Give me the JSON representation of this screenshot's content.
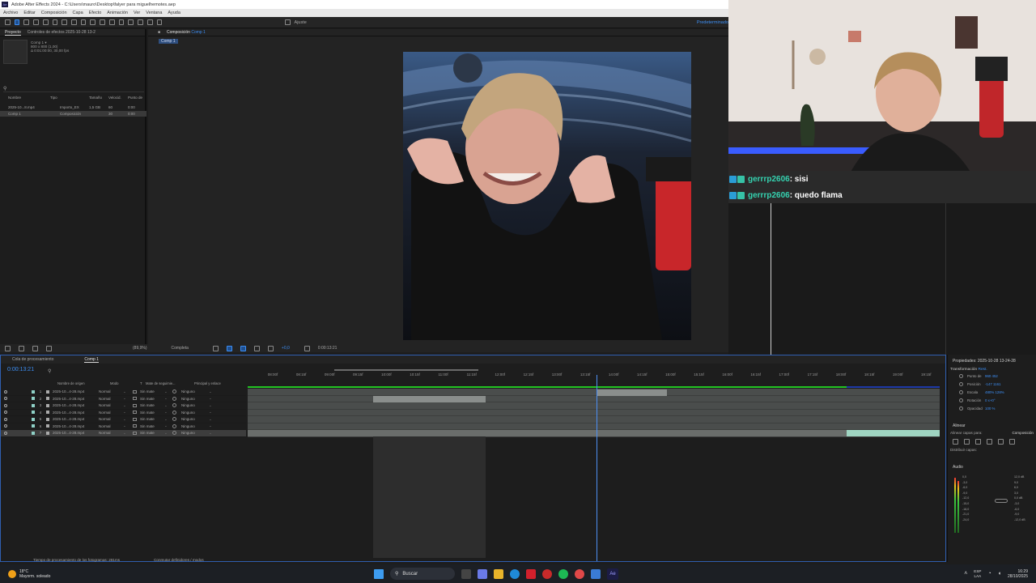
{
  "app": {
    "title": "Adobe After Effects 2024 - C:\\Users\\mauro\\Desktop\\falyer para miguelhemotes.aep",
    "menu": [
      "Archivo",
      "Editar",
      "Composición",
      "Capa",
      "Efecto",
      "Animación",
      "Ver",
      "Ventana",
      "Ayuda"
    ],
    "workspace": "Predeterminado",
    "ajuste": "Ajuste"
  },
  "project": {
    "tabs": [
      "Proyecto",
      "Controles de efectos 2025-10-28 13-2"
    ],
    "comp_name": "Comp 1 ▾",
    "comp_info": [
      "800 x 800 (1,00)",
      "Δ 0:01:00:00, 30,00 fps"
    ],
    "columns": [
      "Nombre",
      "Tipo",
      "Tamaño",
      "Velocid.",
      "Punto de"
    ],
    "items": [
      {
        "name": "2025-10...8.mp4",
        "type": "Importo_EX",
        "size": "1,5 GB",
        "speed": "60",
        "point": "0:00"
      },
      {
        "name": "Comp 1",
        "type": "Composición",
        "size": "",
        "speed": "30",
        "point": "0:00"
      }
    ]
  },
  "composition": {
    "tab_label": "Composición",
    "tab_comp": "Comp 1",
    "breadcrumb": "Comp 1",
    "zoom": "(89,9%)",
    "resolution": "Completa",
    "exposure": "+0,0",
    "current_time": "0:00:13:21"
  },
  "chat": {
    "messages": [
      {
        "user": "gerrrp2606",
        "text": " : sisi"
      },
      {
        "user": "gerrrp2606",
        "text": " : quedo flama"
      }
    ]
  },
  "timeline": {
    "tabs": [
      "Cola de procesamiento",
      "Comp 1"
    ],
    "timecode": "0:00:13:21",
    "columns": [
      "Nombre de origen",
      "Modo",
      "T",
      "Mate de seguimie...",
      "Principal y enlace"
    ],
    "ruler": [
      "08:00f",
      "08:15f",
      "09:00f",
      "09:15f",
      "10:00f",
      "10:15f",
      "11:00f",
      "11:15f",
      "12:00f",
      "12:15f",
      "13:00f",
      "13:15f",
      "14:00f",
      "14:15f",
      "15:00f",
      "15:15f",
      "16:00f",
      "16:15f",
      "17:00f",
      "17:15f",
      "18:00f",
      "18:15f",
      "19:00f",
      "19:15f"
    ],
    "layers": [
      {
        "n": "1",
        "name": "2025-10...4-28.mp4",
        "mode": "Normal",
        "matte": "Sin mate",
        "parent": "Ninguno"
      },
      {
        "n": "2",
        "name": "2025-10...4-28.mp4",
        "mode": "Normal",
        "matte": "Sin mate",
        "parent": "Ninguno"
      },
      {
        "n": "3",
        "name": "2025-10...4-28.mp4",
        "mode": "Normal",
        "matte": "Sin mate",
        "parent": "Ninguno"
      },
      {
        "n": "4",
        "name": "2025-10...4-28.mp4",
        "mode": "Normal",
        "matte": "Sin mate",
        "parent": "Ninguno"
      },
      {
        "n": "5",
        "name": "2025-10...4-28.mp4",
        "mode": "Normal",
        "matte": "Sin mate",
        "parent": "Ninguno"
      },
      {
        "n": "6",
        "name": "2025-10...4-28.mp4",
        "mode": "Normal",
        "matte": "Sin mate",
        "parent": "Ninguno"
      },
      {
        "n": "7",
        "name": "2025-10...4-28.mp4",
        "mode": "Normal",
        "matte": "Sin mate",
        "parent": "Ninguno"
      }
    ],
    "footer_render": "Tiempo de procesamiento de los fotogramas: 281ms",
    "footer_toggle": "Conmutar definidores / modos"
  },
  "properties": {
    "title": "Propiedades: 2025-10-28 13-24-28",
    "transform": "Transformación",
    "reset": "Rest.",
    "rows": [
      {
        "label": "Punto de",
        "value": "960  452"
      },
      {
        "label": "Posición",
        "value": "-147  1161"
      },
      {
        "label": "Escala",
        "value": "480%  128%"
      },
      {
        "label": "Rotación",
        "value": "0 x+0°"
      },
      {
        "label": "Opacidad",
        "value": "100 %"
      }
    ],
    "align_title": "Alinear",
    "align_to_label": "Alinear capas para:",
    "align_to_value": "Composición",
    "distribute": "Distribuir capas:",
    "audio_title": "Audio",
    "audio_left": [
      "0,0",
      "-3,0",
      "-6,0",
      "-9,0",
      "-12,0",
      "-15,0",
      "-18,0",
      "-21,0",
      "-24,0"
    ],
    "audio_right": [
      "12,0 dB",
      "9,0",
      "6,0",
      "3,0",
      "0,0 dB",
      "-3,0",
      "-6,0",
      "-9,0",
      "-12,0 dB"
    ]
  },
  "taskbar": {
    "weather_temp": "18°C",
    "weather_desc": "Mayorm. soleado",
    "search": "Buscar",
    "lang_top": "ESP",
    "lang_bottom": "LAA",
    "time": "16:29",
    "date": "28/10/2025"
  }
}
